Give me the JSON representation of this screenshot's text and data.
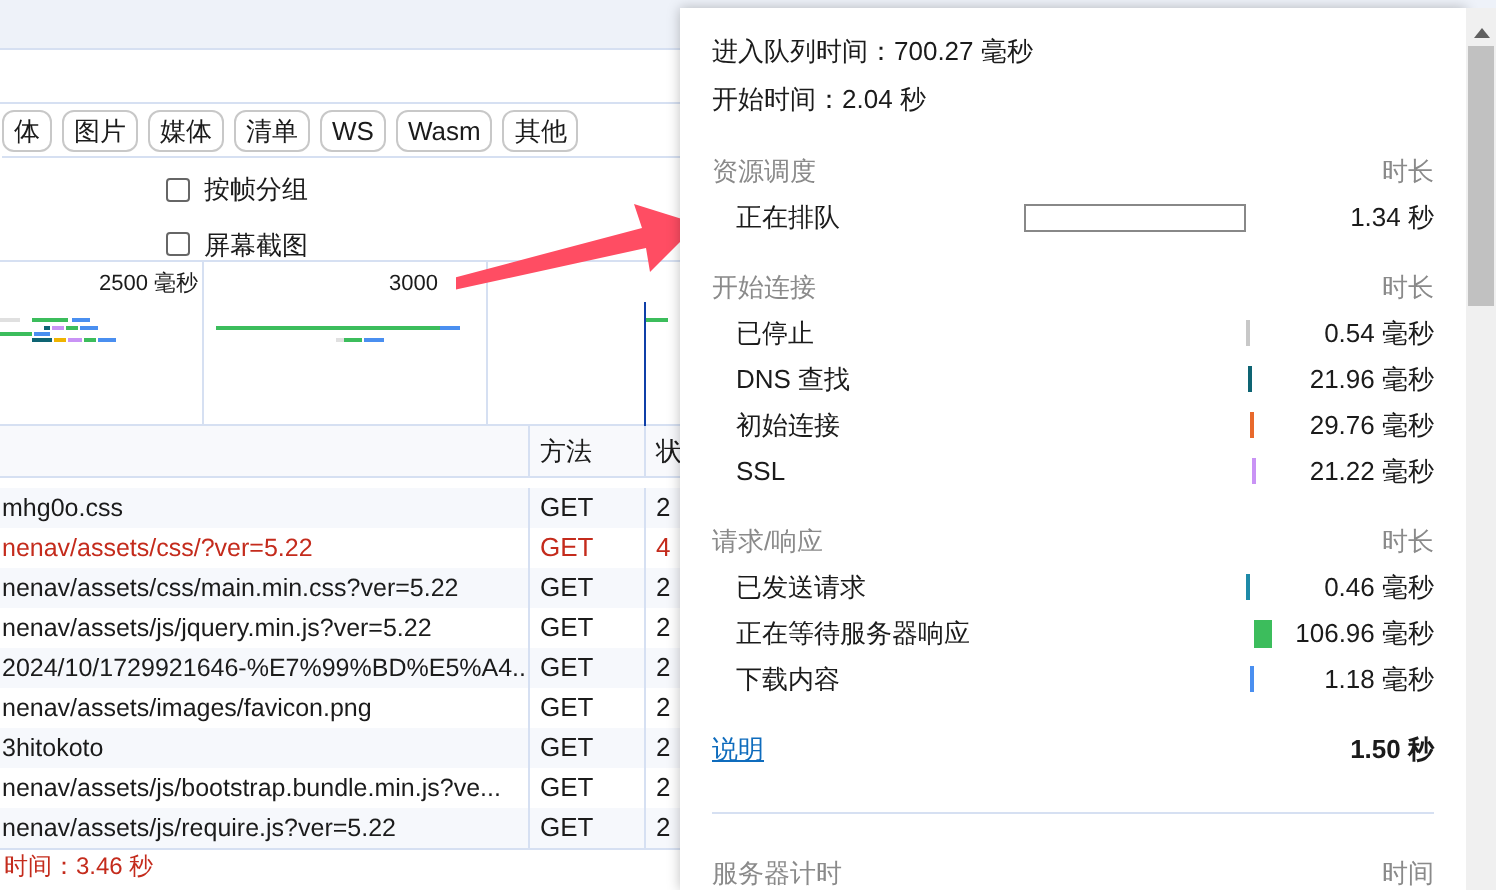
{
  "filters": [
    {
      "label": "体"
    },
    {
      "label": "图片"
    },
    {
      "label": "媒体"
    },
    {
      "label": "清单"
    },
    {
      "label": "WS"
    },
    {
      "label": "Wasm"
    },
    {
      "label": "其他"
    }
  ],
  "options": [
    {
      "label": "按帧分组",
      "checked": false
    },
    {
      "label": "屏幕截图",
      "checked": false
    }
  ],
  "timeline": {
    "ticks": [
      "2500 毫秒",
      "3000"
    ]
  },
  "table": {
    "columns": [
      "方法",
      "状"
    ],
    "rows": [
      {
        "name": "mhg0o.css",
        "method": "GET",
        "column_3": "2",
        "error": false
      },
      {
        "name": "nenav/assets/css/?ver=5.22",
        "method": "GET",
        "column_3": "4",
        "error": true
      },
      {
        "name": "nenav/assets/css/main.min.css?ver=5.22",
        "method": "GET",
        "column_3": "2",
        "error": false
      },
      {
        "name": "nenav/assets/js/jquery.min.js?ver=5.22",
        "method": "GET",
        "column_3": "2",
        "error": false
      },
      {
        "name": "2024/10/1729921646-%E7%99%BD%E5%A4...",
        "method": "GET",
        "column_3": "2",
        "error": false
      },
      {
        "name": "nenav/assets/images/favicon.png",
        "method": "GET",
        "column_3": "2",
        "error": false
      },
      {
        "name": "3hitokoto",
        "method": "GET",
        "column_3": "2",
        "error": false
      },
      {
        "name": "nenav/assets/js/bootstrap.bundle.min.js?ve...",
        "method": "GET",
        "column_3": "2",
        "error": false
      },
      {
        "name": "nenav/assets/js/require.js?ver=5.22",
        "method": "GET",
        "column_3": "2",
        "error": false
      }
    ]
  },
  "status_bar": "时间：3.46 秒",
  "popup": {
    "queued": "进入队列时间：700.27 毫秒",
    "started": "开始时间：2.04 秒",
    "sections": [
      {
        "title": "资源调度",
        "column": "时长",
        "rows": [
          {
            "label": "正在排队",
            "kind": "outline",
            "color": "#888888",
            "value": "1.34 秒"
          }
        ]
      },
      {
        "title": "开始连接",
        "column": "时长",
        "rows": [
          {
            "label": "已停止",
            "kind": "tick",
            "color": "#c8c8c8",
            "value": "0.54 毫秒"
          },
          {
            "label": "DNS 查找",
            "kind": "tick",
            "color": "#0e6473",
            "value": "21.96 毫秒"
          },
          {
            "label": "初始连接",
            "kind": "tick",
            "color": "#e8692c",
            "value": "29.76 毫秒"
          },
          {
            "label": "SSL",
            "kind": "tick",
            "color": "#c993f5",
            "value": "21.22 毫秒"
          }
        ]
      },
      {
        "title": "请求/响应",
        "column": "时长",
        "rows": [
          {
            "label": "已发送请求",
            "kind": "tick",
            "color": "#1e8aa8",
            "value": "0.46 毫秒"
          },
          {
            "label": "正在等待服务器响应",
            "kind": "block",
            "color": "#3cbd5c",
            "value": "106.96 毫秒"
          },
          {
            "label": "下载内容",
            "kind": "tick",
            "color": "#4a8ff0",
            "value": "1.18 毫秒"
          }
        ]
      }
    ],
    "link": "说明",
    "total": "1.50 秒",
    "server": {
      "title": "服务器计时",
      "column": "时间"
    }
  }
}
